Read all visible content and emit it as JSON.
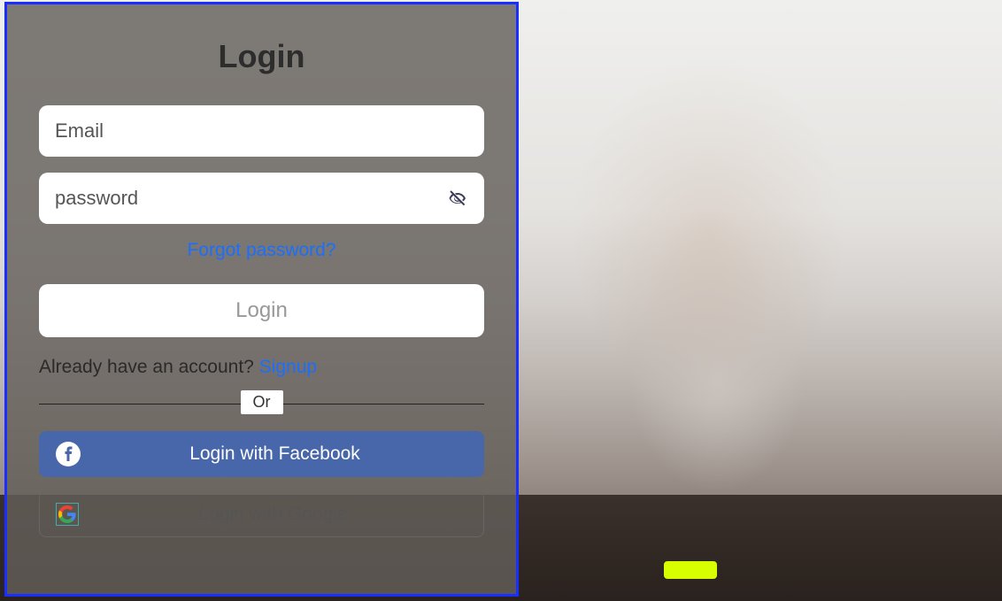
{
  "login": {
    "title": "Login",
    "email_placeholder": "Email",
    "password_placeholder": "password",
    "forgot_label": "Forgot password?",
    "login_button_label": "Login",
    "signup_prompt_prefix": "Already have an account? ",
    "signup_link_label": "Signup",
    "or_label": "Or",
    "facebook_label": "Login with Facebook",
    "google_label": "Login with Google"
  }
}
